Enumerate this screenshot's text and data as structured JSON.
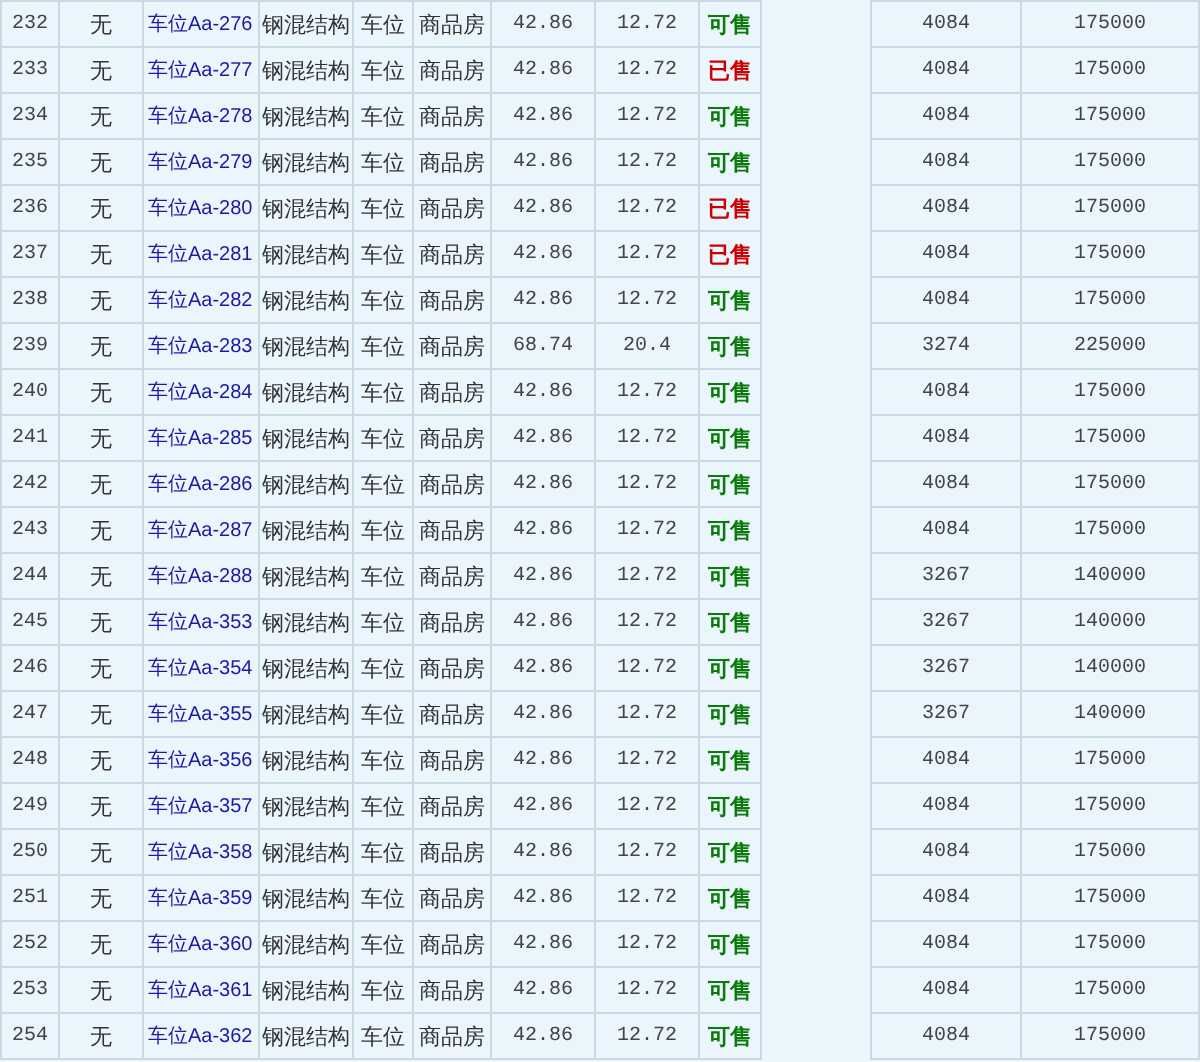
{
  "table": {
    "rows": [
      {
        "column_1": "232",
        "column_2": "无",
        "column_3": "车位Aa-276",
        "column_4": "钢混结构",
        "column_5": "车位",
        "column_6": "商品房",
        "column_7": "42.86",
        "column_8": "12.72",
        "column_9": "可售",
        "sold": false,
        "column_11": "4084",
        "column_12": "175000"
      },
      {
        "column_1": "233",
        "column_2": "无",
        "column_3": "车位Aa-277",
        "column_4": "钢混结构",
        "column_5": "车位",
        "column_6": "商品房",
        "column_7": "42.86",
        "column_8": "12.72",
        "column_9": "已售",
        "sold": true,
        "column_11": "4084",
        "column_12": "175000"
      },
      {
        "column_1": "234",
        "column_2": "无",
        "column_3": "车位Aa-278",
        "column_4": "钢混结构",
        "column_5": "车位",
        "column_6": "商品房",
        "column_7": "42.86",
        "column_8": "12.72",
        "column_9": "可售",
        "sold": false,
        "column_11": "4084",
        "column_12": "175000"
      },
      {
        "column_1": "235",
        "column_2": "无",
        "column_3": "车位Aa-279",
        "column_4": "钢混结构",
        "column_5": "车位",
        "column_6": "商品房",
        "column_7": "42.86",
        "column_8": "12.72",
        "column_9": "可售",
        "sold": false,
        "column_11": "4084",
        "column_12": "175000"
      },
      {
        "column_1": "236",
        "column_2": "无",
        "column_3": "车位Aa-280",
        "column_4": "钢混结构",
        "column_5": "车位",
        "column_6": "商品房",
        "column_7": "42.86",
        "column_8": "12.72",
        "column_9": "已售",
        "sold": true,
        "column_11": "4084",
        "column_12": "175000"
      },
      {
        "column_1": "237",
        "column_2": "无",
        "column_3": "车位Aa-281",
        "column_4": "钢混结构",
        "column_5": "车位",
        "column_6": "商品房",
        "column_7": "42.86",
        "column_8": "12.72",
        "column_9": "已售",
        "sold": true,
        "column_11": "4084",
        "column_12": "175000"
      },
      {
        "column_1": "238",
        "column_2": "无",
        "column_3": "车位Aa-282",
        "column_4": "钢混结构",
        "column_5": "车位",
        "column_6": "商品房",
        "column_7": "42.86",
        "column_8": "12.72",
        "column_9": "可售",
        "sold": false,
        "column_11": "4084",
        "column_12": "175000"
      },
      {
        "column_1": "239",
        "column_2": "无",
        "column_3": "车位Aa-283",
        "column_4": "钢混结构",
        "column_5": "车位",
        "column_6": "商品房",
        "column_7": "68.74",
        "column_8": "20.4",
        "column_9": "可售",
        "sold": false,
        "column_11": "3274",
        "column_12": "225000"
      },
      {
        "column_1": "240",
        "column_2": "无",
        "column_3": "车位Aa-284",
        "column_4": "钢混结构",
        "column_5": "车位",
        "column_6": "商品房",
        "column_7": "42.86",
        "column_8": "12.72",
        "column_9": "可售",
        "sold": false,
        "column_11": "4084",
        "column_12": "175000"
      },
      {
        "column_1": "241",
        "column_2": "无",
        "column_3": "车位Aa-285",
        "column_4": "钢混结构",
        "column_5": "车位",
        "column_6": "商品房",
        "column_7": "42.86",
        "column_8": "12.72",
        "column_9": "可售",
        "sold": false,
        "column_11": "4084",
        "column_12": "175000"
      },
      {
        "column_1": "242",
        "column_2": "无",
        "column_3": "车位Aa-286",
        "column_4": "钢混结构",
        "column_5": "车位",
        "column_6": "商品房",
        "column_7": "42.86",
        "column_8": "12.72",
        "column_9": "可售",
        "sold": false,
        "column_11": "4084",
        "column_12": "175000"
      },
      {
        "column_1": "243",
        "column_2": "无",
        "column_3": "车位Aa-287",
        "column_4": "钢混结构",
        "column_5": "车位",
        "column_6": "商品房",
        "column_7": "42.86",
        "column_8": "12.72",
        "column_9": "可售",
        "sold": false,
        "column_11": "4084",
        "column_12": "175000"
      },
      {
        "column_1": "244",
        "column_2": "无",
        "column_3": "车位Aa-288",
        "column_4": "钢混结构",
        "column_5": "车位",
        "column_6": "商品房",
        "column_7": "42.86",
        "column_8": "12.72",
        "column_9": "可售",
        "sold": false,
        "column_11": "3267",
        "column_12": "140000"
      },
      {
        "column_1": "245",
        "column_2": "无",
        "column_3": "车位Aa-353",
        "column_4": "钢混结构",
        "column_5": "车位",
        "column_6": "商品房",
        "column_7": "42.86",
        "column_8": "12.72",
        "column_9": "可售",
        "sold": false,
        "column_11": "3267",
        "column_12": "140000"
      },
      {
        "column_1": "246",
        "column_2": "无",
        "column_3": "车位Aa-354",
        "column_4": "钢混结构",
        "column_5": "车位",
        "column_6": "商品房",
        "column_7": "42.86",
        "column_8": "12.72",
        "column_9": "可售",
        "sold": false,
        "column_11": "3267",
        "column_12": "140000"
      },
      {
        "column_1": "247",
        "column_2": "无",
        "column_3": "车位Aa-355",
        "column_4": "钢混结构",
        "column_5": "车位",
        "column_6": "商品房",
        "column_7": "42.86",
        "column_8": "12.72",
        "column_9": "可售",
        "sold": false,
        "column_11": "3267",
        "column_12": "140000"
      },
      {
        "column_1": "248",
        "column_2": "无",
        "column_3": "车位Aa-356",
        "column_4": "钢混结构",
        "column_5": "车位",
        "column_6": "商品房",
        "column_7": "42.86",
        "column_8": "12.72",
        "column_9": "可售",
        "sold": false,
        "column_11": "4084",
        "column_12": "175000"
      },
      {
        "column_1": "249",
        "column_2": "无",
        "column_3": "车位Aa-357",
        "column_4": "钢混结构",
        "column_5": "车位",
        "column_6": "商品房",
        "column_7": "42.86",
        "column_8": "12.72",
        "column_9": "可售",
        "sold": false,
        "column_11": "4084",
        "column_12": "175000"
      },
      {
        "column_1": "250",
        "column_2": "无",
        "column_3": "车位Aa-358",
        "column_4": "钢混结构",
        "column_5": "车位",
        "column_6": "商品房",
        "column_7": "42.86",
        "column_8": "12.72",
        "column_9": "可售",
        "sold": false,
        "column_11": "4084",
        "column_12": "175000"
      },
      {
        "column_1": "251",
        "column_2": "无",
        "column_3": "车位Aa-359",
        "column_4": "钢混结构",
        "column_5": "车位",
        "column_6": "商品房",
        "column_7": "42.86",
        "column_8": "12.72",
        "column_9": "可售",
        "sold": false,
        "column_11": "4084",
        "column_12": "175000"
      },
      {
        "column_1": "252",
        "column_2": "无",
        "column_3": "车位Aa-360",
        "column_4": "钢混结构",
        "column_5": "车位",
        "column_6": "商品房",
        "column_7": "42.86",
        "column_8": "12.72",
        "column_9": "可售",
        "sold": false,
        "column_11": "4084",
        "column_12": "175000"
      },
      {
        "column_1": "253",
        "column_2": "无",
        "column_3": "车位Aa-361",
        "column_4": "钢混结构",
        "column_5": "车位",
        "column_6": "商品房",
        "column_7": "42.86",
        "column_8": "12.72",
        "column_9": "可售",
        "sold": false,
        "column_11": "4084",
        "column_12": "175000"
      },
      {
        "column_1": "254",
        "column_2": "无",
        "column_3": "车位Aa-362",
        "column_4": "钢混结构",
        "column_5": "车位",
        "column_6": "商品房",
        "column_7": "42.86",
        "column_8": "12.72",
        "column_9": "可售",
        "sold": false,
        "column_11": "4084",
        "column_12": "175000"
      }
    ]
  }
}
